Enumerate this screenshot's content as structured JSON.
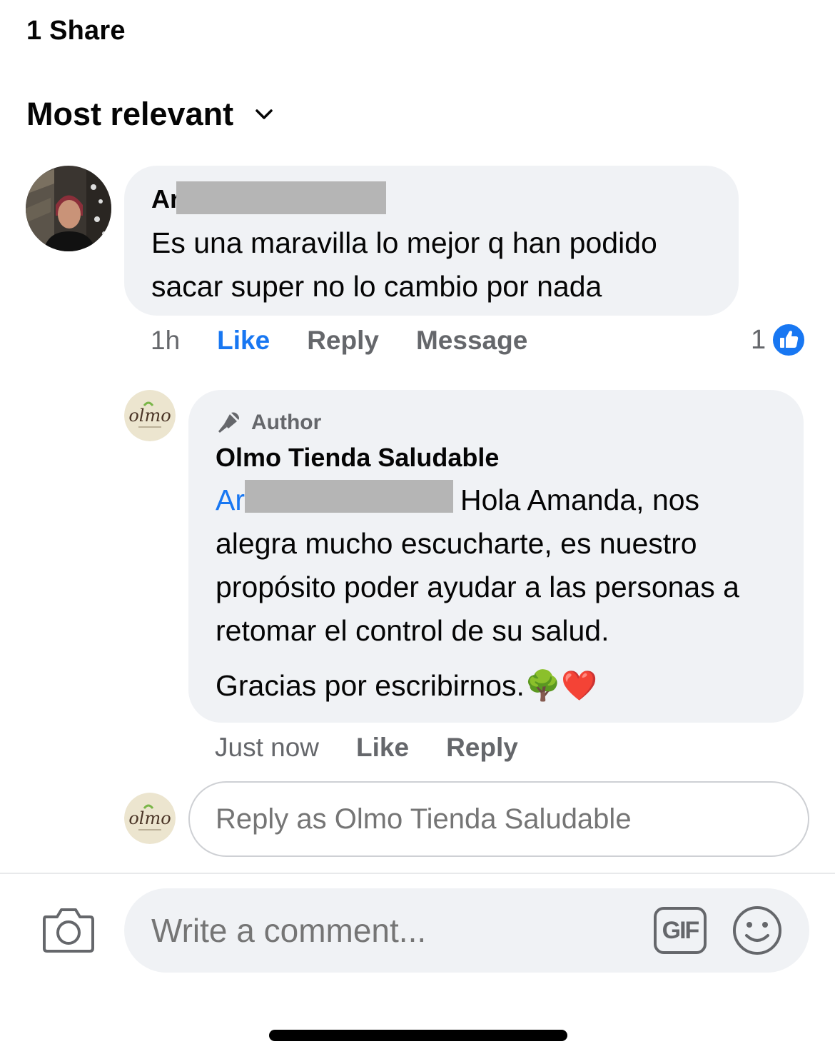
{
  "header": {
    "share_count": "1 Share",
    "sort_label": "Most relevant"
  },
  "comment": {
    "author_visible": "Ar",
    "text": "Es una maravilla lo mejor q han podido sacar super no lo cambio por nada",
    "time": "1h",
    "like_label": "Like",
    "reply_label": "Reply",
    "message_label": "Message",
    "reaction_count": "1"
  },
  "reply": {
    "badge": "Author",
    "author": "Olmo Tienda Saludable",
    "mention_visible": "Ar",
    "text": "Hola Amanda, nos alegra mucho escucharte, es nuestro propósito poder ayudar a las personas a retomar el control de su salud.",
    "text2": "Gracias por escribirnos.",
    "emojis": "🌳❤️",
    "time": "Just now",
    "like_label": "Like",
    "reply_label": "Reply"
  },
  "reply_box": {
    "placeholder": "Reply as Olmo Tienda Saludable"
  },
  "composer": {
    "placeholder": "Write a comment...",
    "gif_label": "GIF"
  },
  "colors": {
    "accent": "#1877f2",
    "bubble": "#f0f2f5",
    "secondary_text": "#65676b"
  }
}
